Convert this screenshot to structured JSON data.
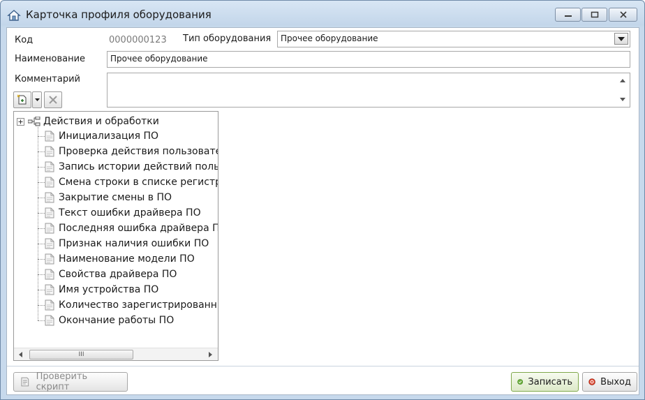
{
  "window": {
    "title": "Карточка профиля оборудования",
    "icons": {
      "app": "home-icon",
      "minimize": "minimize-icon",
      "maximize": "maximize-icon",
      "close": "close-icon"
    }
  },
  "form": {
    "code_label": "Код",
    "code_value": "0000000123",
    "type_label": "Тип оборудования",
    "type_value": "Прочее оборудование",
    "name_label": "Наименование",
    "name_value": "Прочее оборудование",
    "comment_label": "Комментарий",
    "comment_value": ""
  },
  "toolbar": {
    "add_icon": "add-page-icon",
    "dropdown_icon": "chevron-down-icon",
    "delete_icon": "delete-icon"
  },
  "tree": {
    "root_label": "Действия и обработки",
    "items": [
      "Инициализация ПО",
      "Проверка действия пользовател",
      "Запись истории действий польз",
      "Смена строки в списке регистра",
      "Закрытие смены в ПО",
      "Текст ошибки драйвера ПО",
      "Последняя ошибка драйвера ПО",
      "Признак наличия ошибки ПО",
      "Наименование модели ПО",
      "Свойства драйвера ПО",
      "Имя устройства ПО",
      "Количество зарегистрированны",
      "Окончание работы ПО"
    ],
    "scroll_thumb_label": "III"
  },
  "footer": {
    "check_script_label": "Проверить скрипт",
    "save_label": "Записать",
    "exit_label": "Выход"
  },
  "colors": {
    "accent": "#7fa84a",
    "exit": "#d9412b",
    "title_bg": "#c7d9ec"
  }
}
